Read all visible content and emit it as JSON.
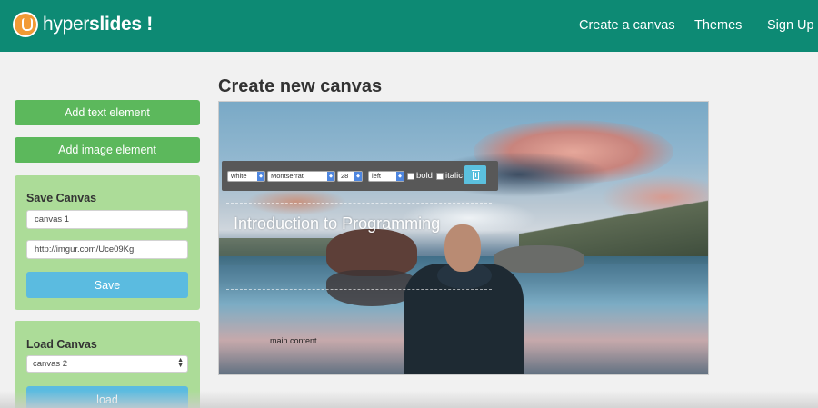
{
  "header": {
    "logo_regular": "hyper",
    "logo_bold": "slides !",
    "nav": [
      "Create a canvas",
      "Themes",
      "Sign Up"
    ]
  },
  "sidebar": {
    "add_text_label": "Add text element",
    "add_image_label": "Add image element",
    "save_panel": {
      "title": "Save Canvas",
      "name_value": "canvas 1",
      "url_value": "http://imgur.com/Uce09Kg",
      "save_label": "Save"
    },
    "load_panel": {
      "title": "Load Canvas",
      "selected": "canvas 2",
      "load_label": "load"
    }
  },
  "main": {
    "title": "Create new canvas",
    "toolbar": {
      "color": "white",
      "font": "Montserrat",
      "size": "28",
      "align": "left",
      "bold_label": "bold",
      "italic_label": "italic",
      "delete_icon": "trash-icon"
    },
    "slide": {
      "title_text": "Introduction to Programming",
      "body_text": "main content"
    }
  },
  "colors": {
    "header": "#0d8a74",
    "green_button": "#5cb85c",
    "panel": "#acdc98",
    "blue_button": "#5bbbe0",
    "toolbar": "#585858"
  }
}
